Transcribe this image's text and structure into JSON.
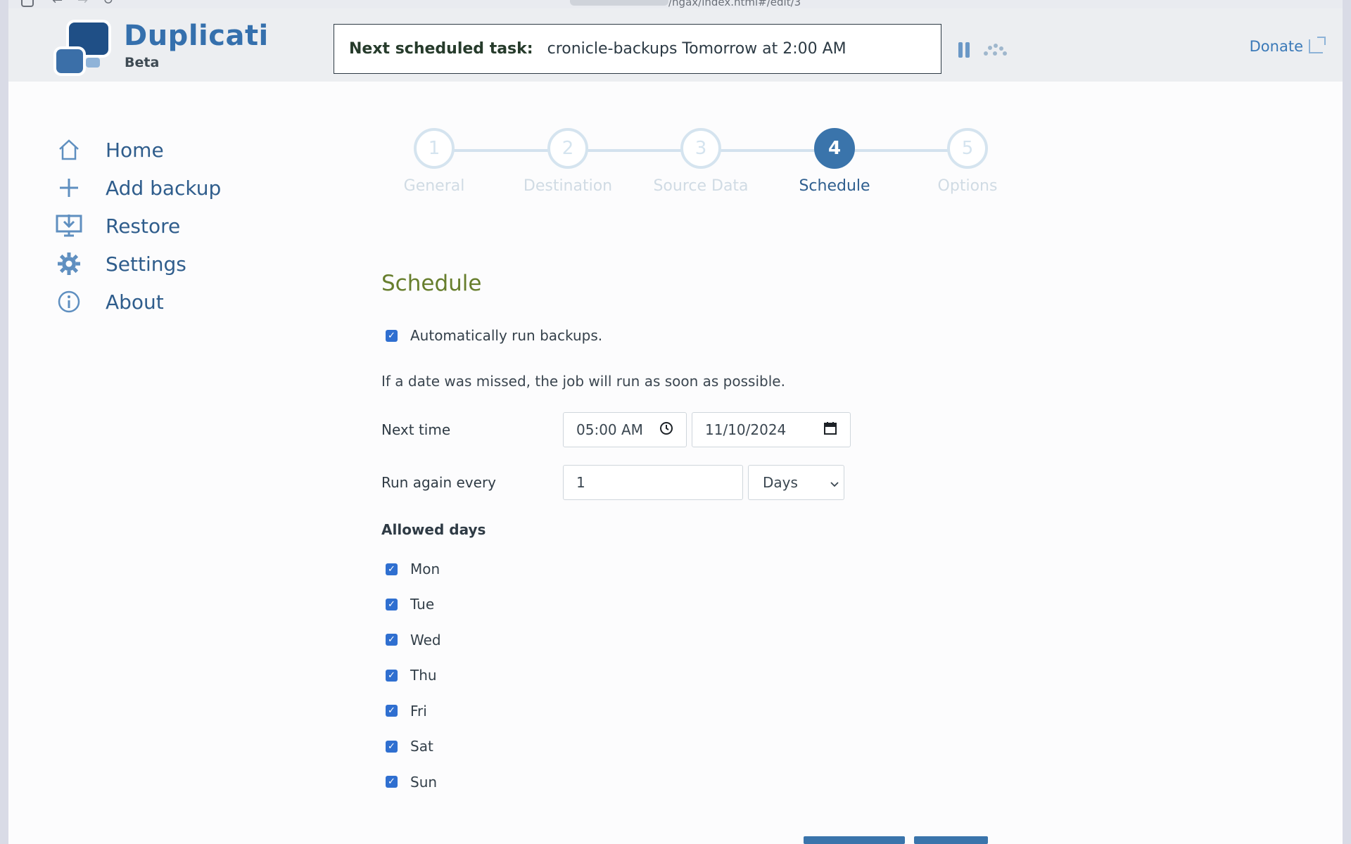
{
  "browser": {
    "url": "/ngax/index.html#/edit/3"
  },
  "header": {
    "brand": "Duplicati",
    "brand_sub": "Beta",
    "task_label": "Next scheduled task:",
    "task_value": "cronicle-backups Tomorrow at 2:00 AM",
    "donate": "Donate"
  },
  "sidebar": {
    "items": [
      {
        "label": "Home",
        "icon": "home-icon"
      },
      {
        "label": "Add backup",
        "icon": "plus-icon"
      },
      {
        "label": "Restore",
        "icon": "restore-icon"
      },
      {
        "label": "Settings",
        "icon": "gear-icon"
      },
      {
        "label": "About",
        "icon": "info-icon"
      }
    ]
  },
  "steps": [
    {
      "num": "1",
      "label": "General"
    },
    {
      "num": "2",
      "label": "Destination"
    },
    {
      "num": "3",
      "label": "Source Data"
    },
    {
      "num": "4",
      "label": "Schedule"
    },
    {
      "num": "5",
      "label": "Options"
    }
  ],
  "schedule": {
    "title": "Schedule",
    "auto_run_label": "Automatically run backups.",
    "missed_note": "If a date was missed, the job will run as soon as possible.",
    "next_time_label": "Next time",
    "next_time_value": "05:00 AM",
    "next_date_value": "11/10/2024",
    "run_again_label": "Run again every",
    "run_again_value": "1",
    "run_again_unit": "Days",
    "allowed_days_label": "Allowed days",
    "days": [
      "Mon",
      "Tue",
      "Wed",
      "Thu",
      "Fri",
      "Sat",
      "Sun"
    ]
  },
  "colors": {
    "accent": "#3a74ab",
    "title_green": "#677e2d",
    "checkbox": "#2f6fd0"
  }
}
